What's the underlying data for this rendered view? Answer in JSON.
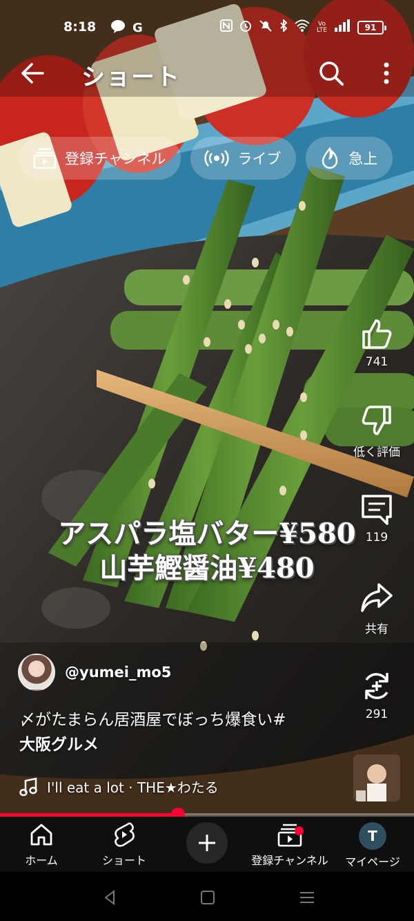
{
  "status_bar": {
    "time": "8:18",
    "left_icons": [
      "line-icon",
      "google-icon"
    ],
    "right_icons": [
      "nfc-icon",
      "alarm-icon",
      "mute-icon",
      "bluetooth-icon",
      "wifi-icon",
      "volte-icon",
      "signal-icon"
    ],
    "battery": "91"
  },
  "header": {
    "title": "ショート"
  },
  "chips": [
    {
      "label": "登録チャンネル",
      "icon": "subscriptions-icon"
    },
    {
      "label": "ライブ",
      "icon": "live-icon"
    },
    {
      "label": "急上",
      "icon": "trending-icon"
    }
  ],
  "video": {
    "caption_line1": "アスパラ塩バター¥580",
    "caption_line2": "山芋鰹醤油¥480",
    "progress": 0.43
  },
  "actions": {
    "like_count": "741",
    "dislike_label": "低く評価",
    "comment_count": "119",
    "share_label": "共有",
    "remix_count": "291"
  },
  "channel": {
    "handle": "@yumei_mo5"
  },
  "description": {
    "text": "〆がたまらん居酒屋でぼっち爆食い#",
    "hashtag": "大阪グルメ"
  },
  "music": {
    "title": "I'll eat a lot · THE★わたる"
  },
  "bottom_nav": {
    "home": "ホーム",
    "shorts": "ショート",
    "subscriptions": "登録チャンネル",
    "you": "マイページ",
    "avatar_letter": "T"
  },
  "colors": {
    "accent": "#ff0033",
    "nav_background": "#0f0f0f",
    "chip_background": "rgba(255,255,255,0.22)"
  }
}
